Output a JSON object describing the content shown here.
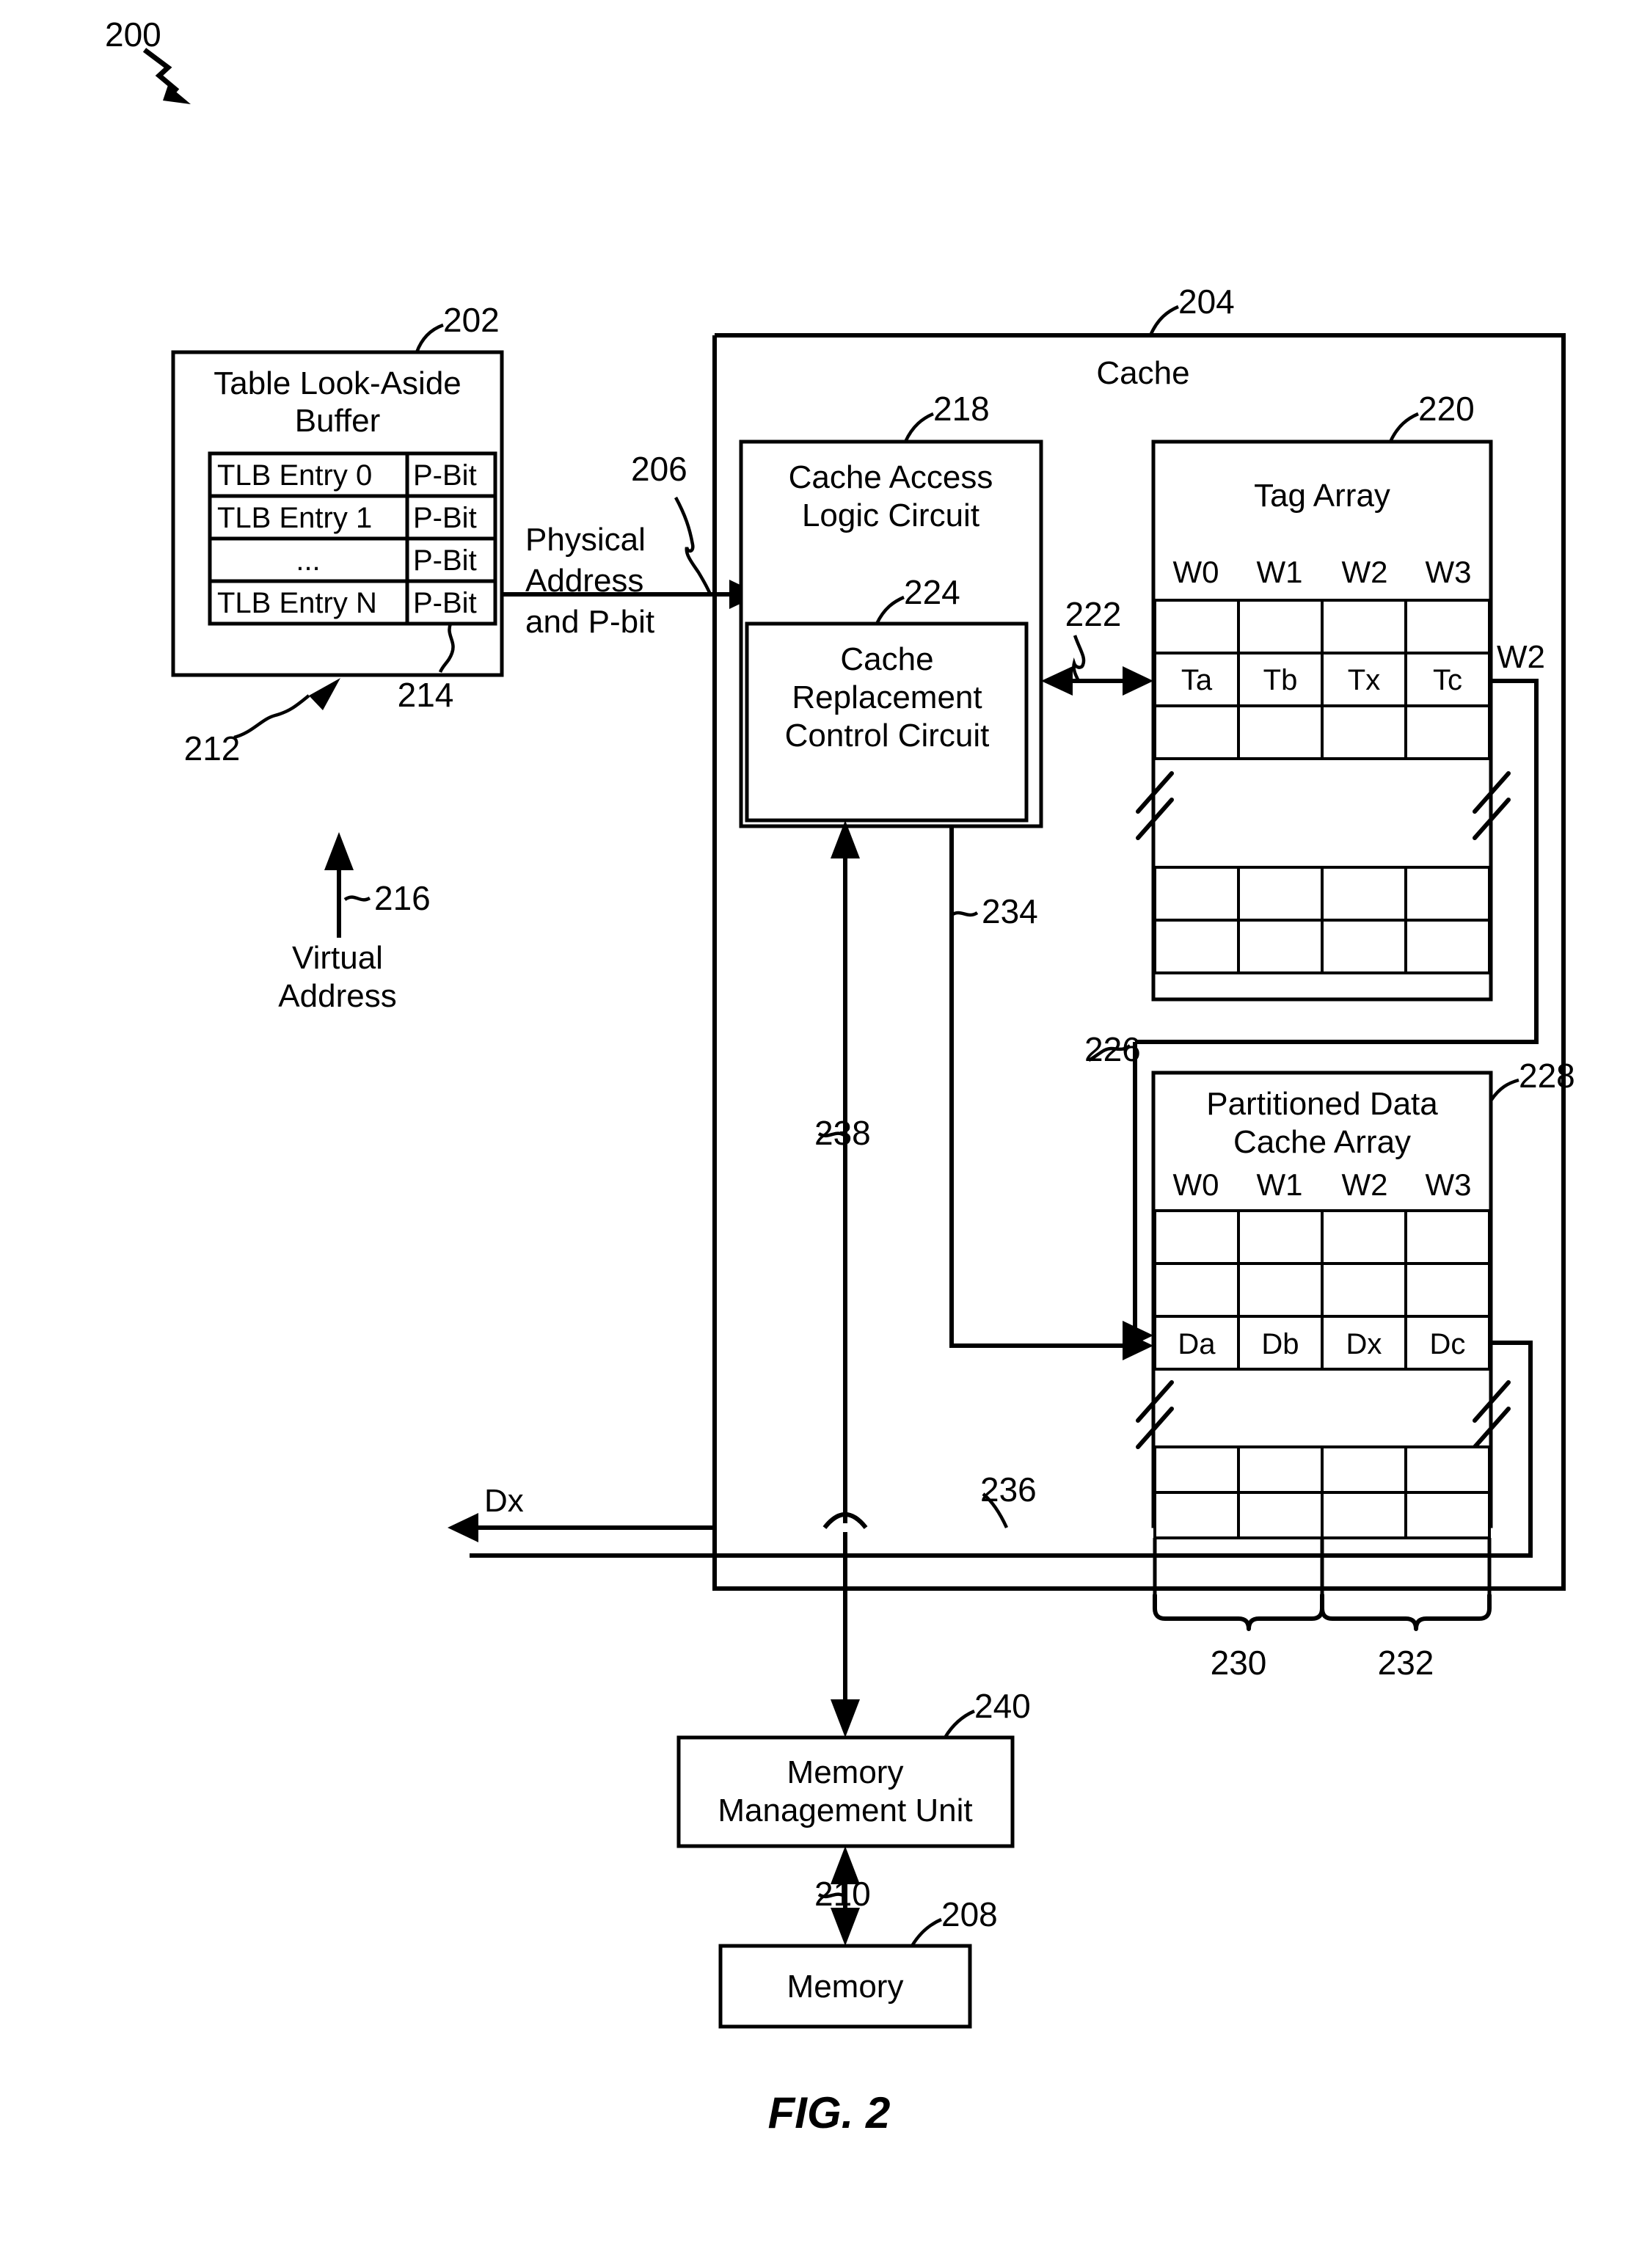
{
  "figure": {
    "caption": "FIG. 2",
    "root_ref": "200"
  },
  "blocks": {
    "tlb": {
      "title_line1": "Table Look-Aside",
      "title_line2": "Buffer",
      "ref": "202",
      "entries_ref": "212",
      "pbit_col_ref": "214",
      "rows": [
        {
          "entry": "TLB Entry 0",
          "pbit": "P-Bit"
        },
        {
          "entry": "TLB Entry 1",
          "pbit": "P-Bit"
        },
        {
          "entry": "...",
          "pbit": "P-Bit"
        },
        {
          "entry": "TLB Entry N",
          "pbit": "P-Bit"
        }
      ]
    },
    "cache": {
      "label": "Cache",
      "ref": "204"
    },
    "cache_access_logic": {
      "title_line1": "Cache Access",
      "title_line2": "Logic Circuit",
      "ref": "218"
    },
    "cache_replacement_control": {
      "title_line1": "Cache",
      "title_line2": "Replacement",
      "title_line3": "Control Circuit",
      "ref": "224"
    },
    "tag_array": {
      "title": "Tag Array",
      "ref": "220",
      "ways": [
        "W0",
        "W1",
        "W2",
        "W3"
      ],
      "tag_row": [
        "Ta",
        "Tb",
        "Tx",
        "Tc"
      ]
    },
    "data_array": {
      "title_line1": "Partitioned Data",
      "title_line2": "Cache Array",
      "ref": "228",
      "ways": [
        "W0",
        "W1",
        "W2",
        "W3"
      ],
      "data_row": [
        "Da",
        "Db",
        "Dx",
        "Dc"
      ],
      "partition_a_ref": "230",
      "partition_b_ref": "232"
    },
    "mmu": {
      "title_line1": "Memory",
      "title_line2": "Management Unit",
      "ref": "240"
    },
    "memory": {
      "title": "Memory",
      "ref": "208"
    }
  },
  "signals": {
    "physical_address": {
      "line1": "Physical",
      "line2": "Address",
      "line3": "and P-bit",
      "ref": "206"
    },
    "virtual_address": {
      "line1": "Virtual",
      "line2": "Address",
      "ref": "216"
    },
    "tag_bus_ref": "222",
    "tag_hit_way": "W2",
    "data_bus_ref": "226",
    "replacement_to_data_ref": "234",
    "data_out": "Dx",
    "data_out_ref": "236",
    "mmu_path_ref": "238",
    "mmu_memory_ref": "210"
  }
}
